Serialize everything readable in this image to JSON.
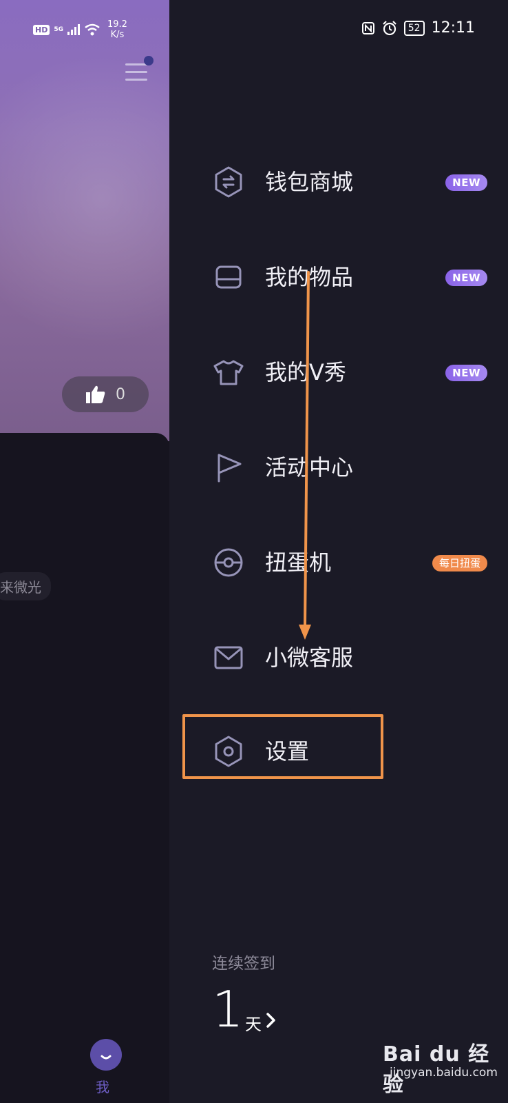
{
  "status_bar": {
    "left": {
      "hd": "HD",
      "network": "5G",
      "speed_value": "19.2",
      "speed_unit": "K/s"
    },
    "right": {
      "battery": "52",
      "time": "12:11"
    }
  },
  "left_panel": {
    "like_count": "0",
    "tag_text": "来微光",
    "bottom_tab_label": "我"
  },
  "menu": {
    "items": [
      {
        "label": "钱包商城",
        "icon": "wallet-mall-icon",
        "badge": "NEW"
      },
      {
        "label": "我的物品",
        "icon": "inventory-box-icon",
        "badge": "NEW"
      },
      {
        "label": "我的V秀",
        "icon": "tshirt-icon",
        "badge": "NEW"
      },
      {
        "label": "活动中心",
        "icon": "flag-icon",
        "badge": ""
      },
      {
        "label": "扭蛋机",
        "icon": "gacha-ball-icon",
        "badge": "每日扭蛋"
      },
      {
        "label": "小微客服",
        "icon": "mail-icon",
        "badge": ""
      },
      {
        "label": "设置",
        "icon": "settings-hexagon-icon",
        "badge": ""
      }
    ]
  },
  "checkin": {
    "label": "连续签到",
    "count": "1",
    "unit": "天"
  },
  "watermark": {
    "main": "Bai du 经验",
    "sub": "jingyan.baidu.com"
  },
  "colors": {
    "accent": "#8a63e8",
    "highlight": "#f0944a",
    "badge_orange": "#f08a4b",
    "background": "#1b1a26"
  }
}
